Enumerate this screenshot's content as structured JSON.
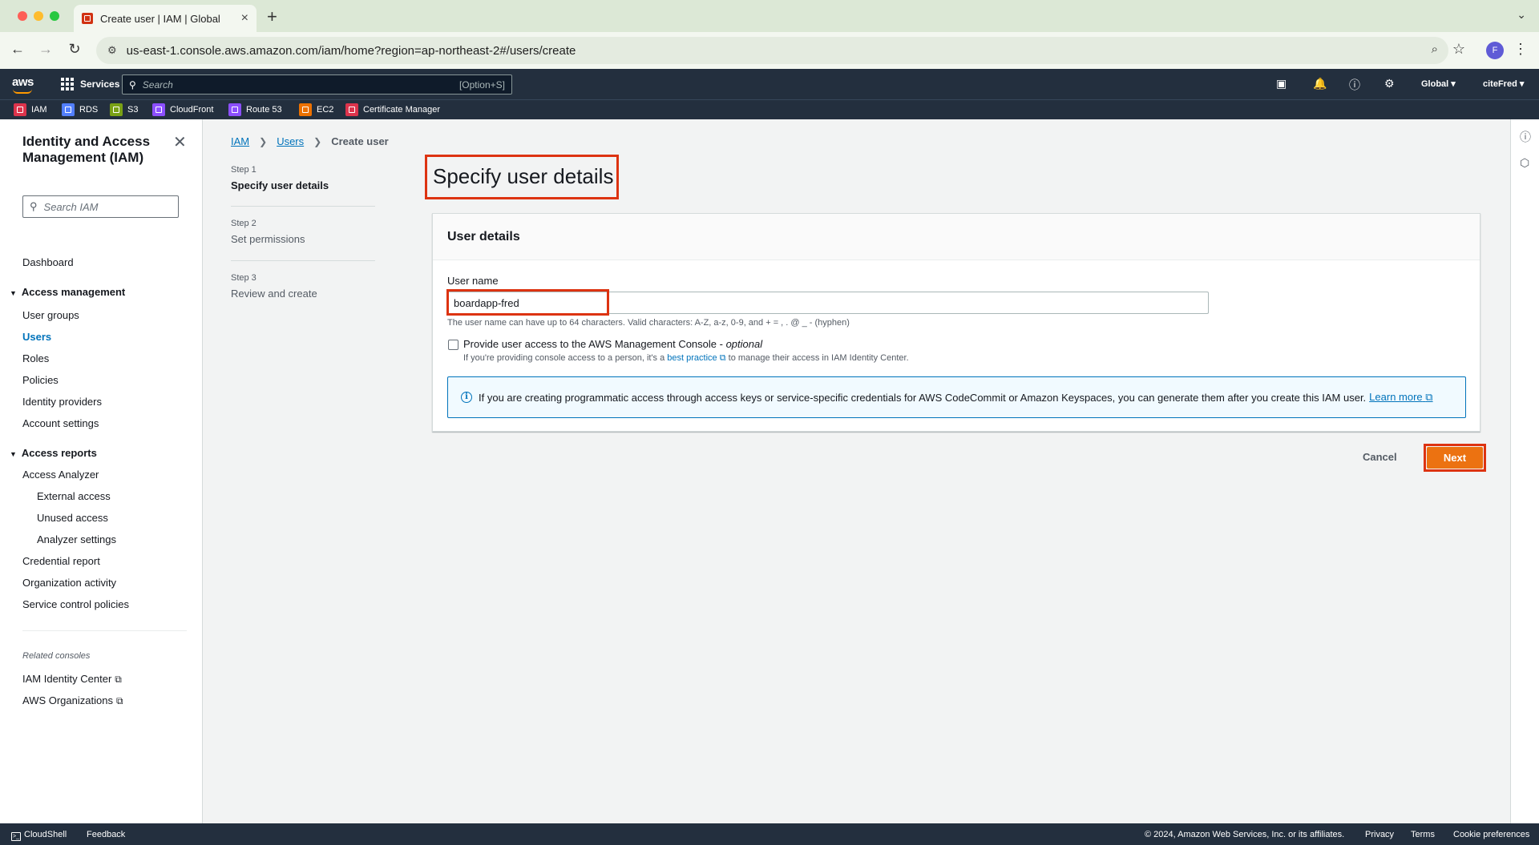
{
  "browser": {
    "tab_title": "Create user | IAM | Global",
    "url": "us-east-1.console.aws.amazon.com/iam/home?region=ap-northeast-2#/users/create",
    "profile_initial": "F"
  },
  "aws_header": {
    "logo": "aws",
    "services_label": "Services",
    "search_placeholder": "Search",
    "search_shortcut": "[Option+S]",
    "region": "Global",
    "account": "citeFred",
    "favorites": [
      {
        "label": "IAM",
        "color": "#dd344c"
      },
      {
        "label": "RDS",
        "color": "#527fff"
      },
      {
        "label": "S3",
        "color": "#7aa116"
      },
      {
        "label": "CloudFront",
        "color": "#8c4fff"
      },
      {
        "label": "Route 53",
        "color": "#8c4fff"
      },
      {
        "label": "EC2",
        "color": "#ed7100"
      },
      {
        "label": "Certificate Manager",
        "color": "#dd344c"
      }
    ]
  },
  "leftnav": {
    "title": "Identity and Access Management (IAM)",
    "search_placeholder": "Search IAM",
    "dashboard": "Dashboard",
    "access_management": {
      "label": "Access management",
      "items": [
        "User groups",
        "Users",
        "Roles",
        "Policies",
        "Identity providers",
        "Account settings"
      ],
      "active": "Users"
    },
    "access_reports": {
      "label": "Access reports",
      "items": [
        "Access Analyzer",
        "External access",
        "Unused access",
        "Analyzer settings",
        "Credential report",
        "Organization activity",
        "Service control policies"
      ]
    },
    "related_label": "Related consoles",
    "related": [
      "IAM Identity Center",
      "AWS Organizations"
    ]
  },
  "breadcrumb": [
    "IAM",
    "Users",
    "Create user"
  ],
  "steps": [
    {
      "num": "Step 1",
      "label": "Specify user details"
    },
    {
      "num": "Step 2",
      "label": "Set permissions"
    },
    {
      "num": "Step 3",
      "label": "Review and create"
    }
  ],
  "main": {
    "page_title": "Specify user details",
    "card_title": "User details",
    "username_label": "User name",
    "username_value": "boardapp-fred",
    "username_hint": "The user name can have up to 64 characters. Valid characters: A-Z, a-z, 0-9, and + = , . @ _ - (hyphen)",
    "console_access_label": "Provide user access to the AWS Management Console - ",
    "console_access_optional": "optional",
    "console_desc_pre": "If you're providing console access to a person, it's a ",
    "console_desc_link": "best practice",
    "console_desc_post": " to manage their access in IAM Identity Center.",
    "info_text": "If you are creating programmatic access through access keys or service-specific credentials for AWS CodeCommit or Amazon Keyspaces, you can generate them after you create this IAM user.",
    "info_link": "Learn more",
    "cancel_label": "Cancel",
    "next_label": "Next"
  },
  "footer": {
    "cloudshell": "CloudShell",
    "feedback": "Feedback",
    "copyright": "© 2024, Amazon Web Services, Inc. or its affiliates.",
    "privacy": "Privacy",
    "terms": "Terms",
    "cookies": "Cookie preferences"
  }
}
